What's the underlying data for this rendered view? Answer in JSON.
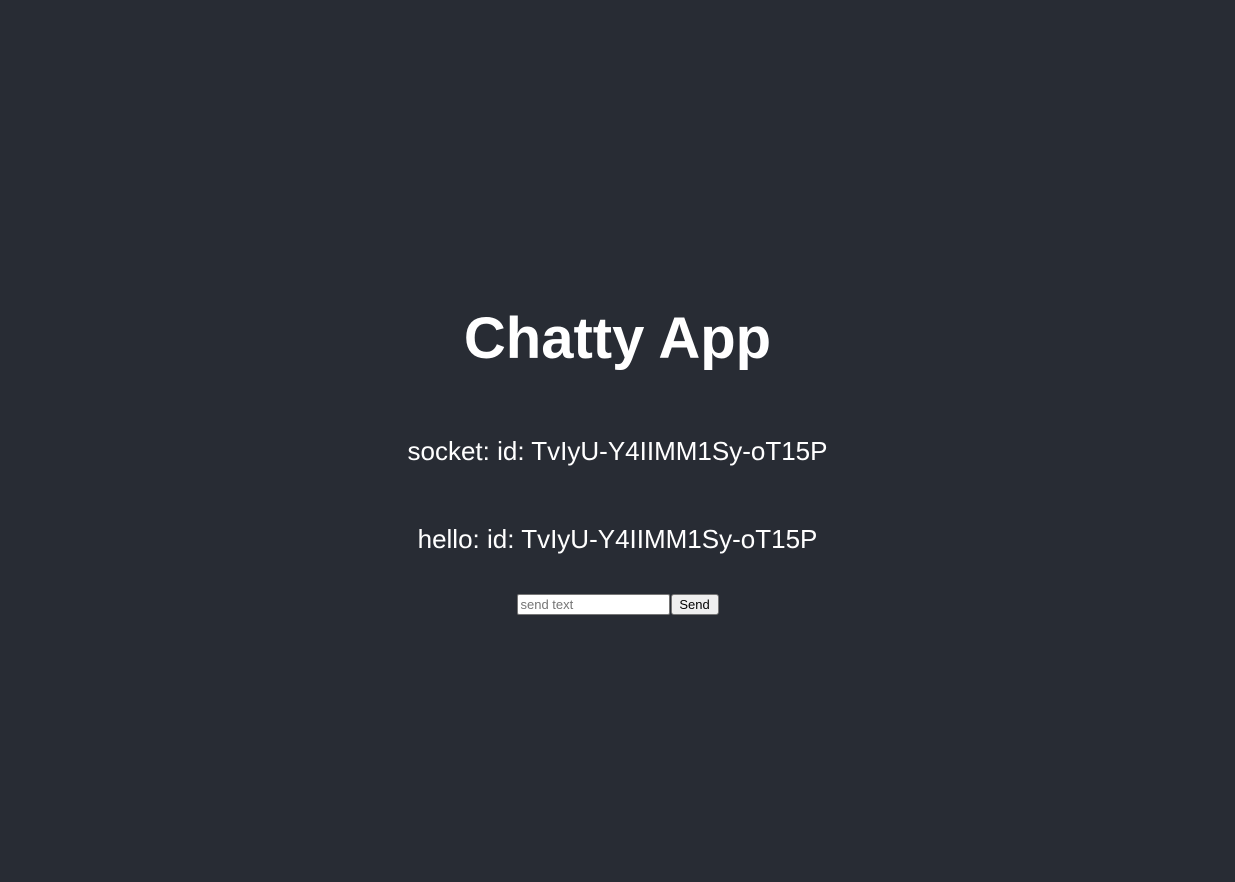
{
  "app": {
    "title": "Chatty App"
  },
  "messages": [
    {
      "text": "socket: id: TvIyU-Y4IIMM1Sy-oT15P"
    },
    {
      "text": "hello: id: TvIyU-Y4IIMM1Sy-oT15P"
    }
  ],
  "composer": {
    "input_value": "",
    "input_placeholder": "send text",
    "send_label": "Send"
  },
  "colors": {
    "background": "#282c34",
    "text": "#ffffff"
  }
}
